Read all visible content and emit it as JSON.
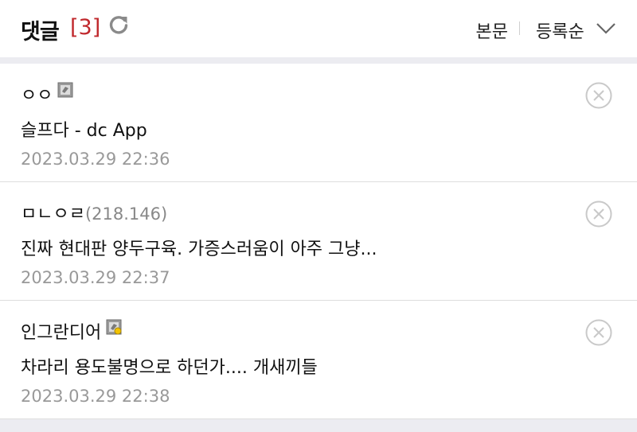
{
  "header": {
    "title": "댓글",
    "count": "[3]",
    "refresh_icon": "refresh-icon",
    "body_button": "본문",
    "sort_button": "등록순",
    "sort_icon": "chevron-down-icon"
  },
  "colors": {
    "count": "#c0282d",
    "band": "#ececf1",
    "date": "#999999"
  },
  "comments": [
    {
      "author": "ㅇㅇ",
      "ip": "",
      "badge": "fixed-nick-badge-icon",
      "text": "슬프다 - dc App",
      "date": "2023.03.29 22:36"
    },
    {
      "author": "ㅁㄴㅇㄹ",
      "ip": "(218.146)",
      "badge": "",
      "text": "진짜 현대판 양두구육. 가증스러움이 아주 그냥...",
      "date": "2023.03.29 22:37"
    },
    {
      "author": "인그란디어",
      "ip": "",
      "badge": "semi-fixed-nick-badge-icon",
      "text": "차라리 용도불명으로 하던가.... 개새끼들",
      "date": "2023.03.29 22:38"
    }
  ]
}
